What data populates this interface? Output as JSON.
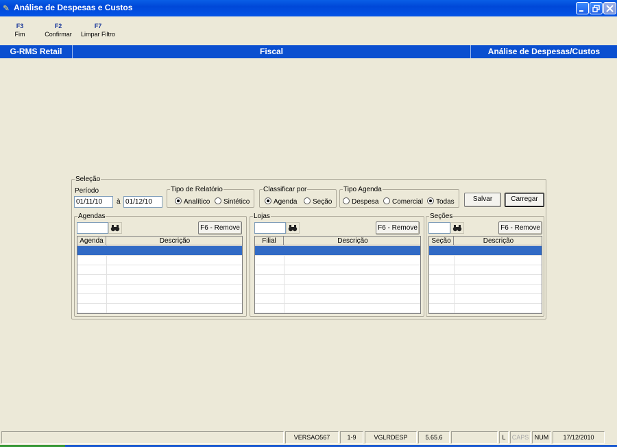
{
  "window": {
    "title": "Análise de Despesas e Custos"
  },
  "toolbar": {
    "items": [
      {
        "key": "F3",
        "label": "Fim"
      },
      {
        "key": "F2",
        "label": "Confirmar"
      },
      {
        "key": "F7",
        "label": "Limpar Filtro"
      }
    ]
  },
  "banner": {
    "left": "G-RMS Retail",
    "center": "Fiscal",
    "right": "Análise de Despesas/Custos"
  },
  "selecao": {
    "legend": "Seleção",
    "periodo": {
      "label": "Período",
      "from": "01/11/10",
      "separator": "à",
      "to": "01/12/10"
    },
    "tipo_relatorio": {
      "legend": "Tipo de Relatório",
      "options": [
        "Analítico",
        "Sintético"
      ],
      "selected": "Analítico"
    },
    "classificar_por": {
      "legend": "Classificar por",
      "options": [
        "Agenda",
        "Seção"
      ],
      "selected": "Agenda"
    },
    "tipo_agenda": {
      "legend": "Tipo Agenda",
      "options": [
        "Despesa",
        "Comercial",
        "Todas"
      ],
      "selected": "Todas"
    },
    "salvar_label": "Salvar",
    "carregar_label": "Carregar"
  },
  "agendas": {
    "legend": "Agendas",
    "remove_label": "F6 - Remove",
    "columns": [
      "Agenda",
      "Descrição"
    ]
  },
  "lojas": {
    "legend": "Lojas",
    "remove_label": "F6 - Remove",
    "columns": [
      "Filial",
      "Descrição"
    ]
  },
  "secoes": {
    "legend": "Seções",
    "remove_label": "F6 - Remove",
    "columns": [
      "Seção",
      "Descrição"
    ]
  },
  "statusbar": {
    "version": "VERSAO567",
    "code": "1-9",
    "program": "VGLRDESP",
    "build": "5.65.6",
    "l": "L",
    "caps": "CAPS",
    "num": "NUM",
    "date": "17/12/2010"
  },
  "colors": {
    "title_blue": "#0a5ee6",
    "banner_blue": "#0a4fd0",
    "selection": "#316ac5",
    "background": "#ece9d8"
  },
  "icons": [
    "app-icon",
    "minimize-icon",
    "restore-icon",
    "close-icon",
    "binoculars-icon"
  ]
}
